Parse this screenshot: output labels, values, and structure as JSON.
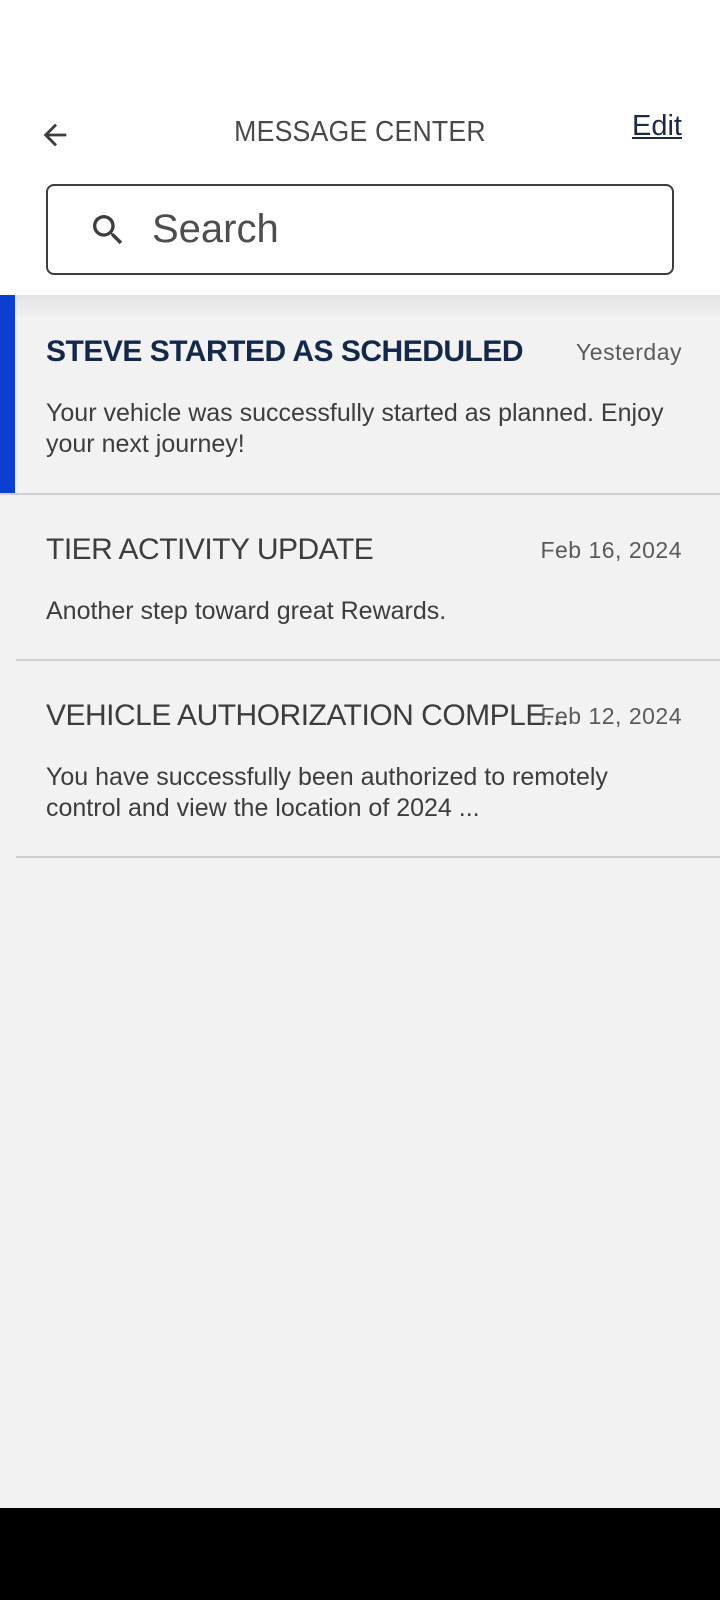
{
  "header": {
    "title": "MESSAGE CENTER",
    "edit_label": "Edit",
    "back_icon": "arrow-left-icon"
  },
  "search": {
    "placeholder": "Search",
    "icon": "search-icon"
  },
  "messages": [
    {
      "title": "STEVE STARTED AS SCHEDULED",
      "date": "Yesterday",
      "body": "Your vehicle was successfully started as planned. Enjoy your next journey!",
      "unread": true
    },
    {
      "title": "TIER ACTIVITY UPDATE",
      "date": "Feb 16, 2024",
      "body": "Another step toward great Rewards.",
      "unread": false
    },
    {
      "title": "VEHICLE AUTHORIZATION COMPLE...",
      "date": "Feb 12, 2024",
      "body": "You have successfully been authorized to remotely control and view the location of 2024 ...",
      "unread": false
    }
  ],
  "colors": {
    "accent_unread": "#0a3fd0",
    "title_unread": "#14284b",
    "background": "#f2f2f2"
  }
}
